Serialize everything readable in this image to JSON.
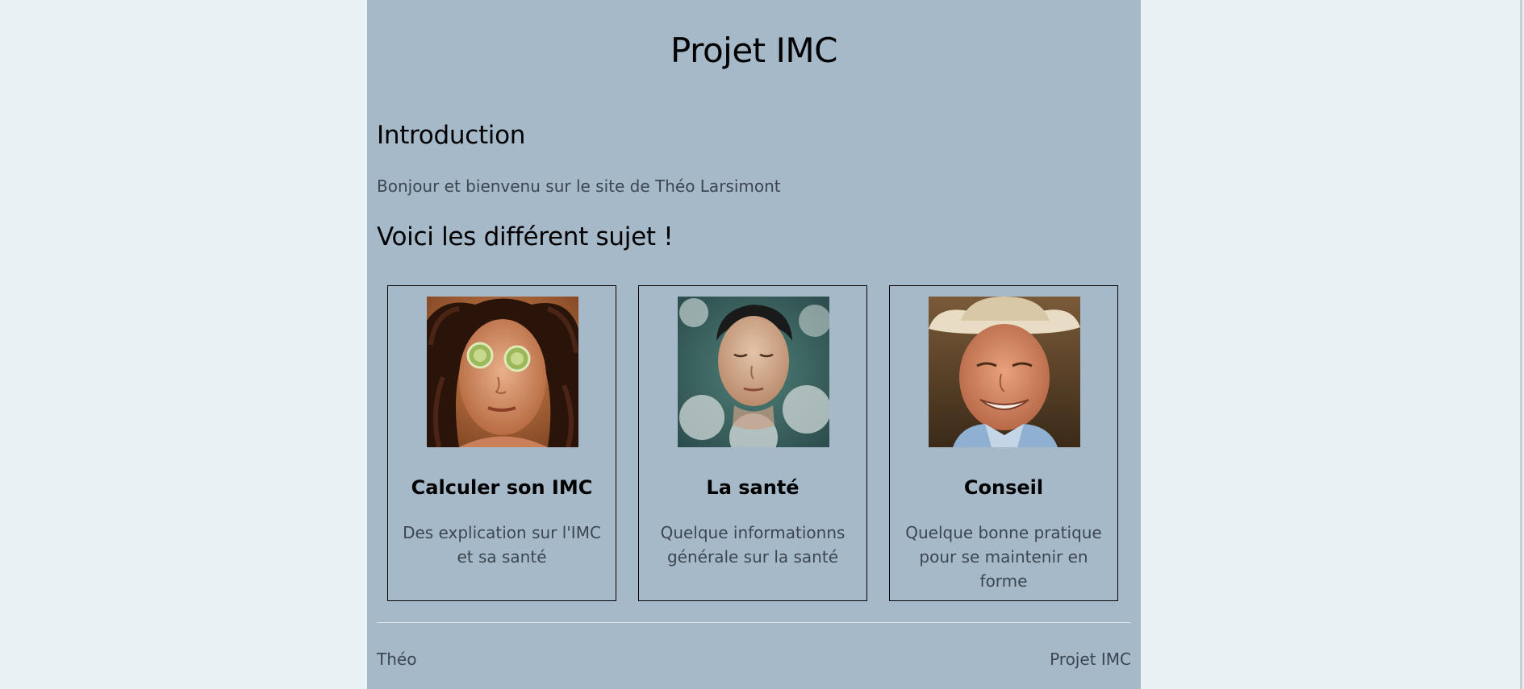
{
  "header": {
    "title": "Projet IMC"
  },
  "intro": {
    "heading": "Introduction",
    "text": "Bonjour et bienvenu sur le site de Théo Larsimont"
  },
  "topics": {
    "heading": "Voici les différent sujet !",
    "cards": [
      {
        "title": "Calculer son IMC",
        "description": "Des explication sur l'IMC et sa santé",
        "image": "woman-with-cucumber-eye-mask-photo"
      },
      {
        "title": "La santé",
        "description": "Quelque informationns générale sur la santé",
        "image": "man-in-bath-foam-photo"
      },
      {
        "title": "Conseil",
        "description": "Quelque bonne pratique pour se maintenir en forme",
        "image": "smiling-man-in-cowboy-hat-photo"
      }
    ]
  },
  "footer": {
    "left": "Théo",
    "right": "Projet IMC"
  },
  "colors": {
    "page_background": "#e8f1f4",
    "content_background": "#a6b9c9",
    "heading_text": "#000000",
    "body_text": "#3c4650"
  }
}
